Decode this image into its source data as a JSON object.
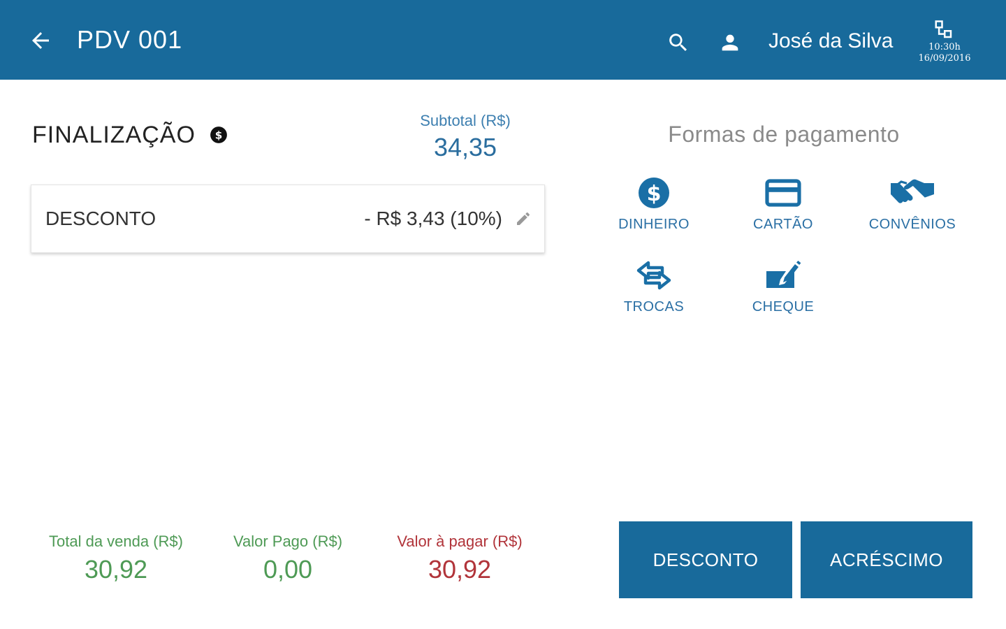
{
  "header": {
    "title": "PDV 001",
    "user_name": "José da Silva",
    "time": "10:30h",
    "date": "16/09/2016",
    "color": "#186a9b"
  },
  "finalization": {
    "title": "FINALIZAÇÃO",
    "subtotal_label": "Subtotal (R$)",
    "subtotal_value": "34,35",
    "discount_label": "DESCONTO",
    "discount_value": "- R$ 3,43 (10%)"
  },
  "payments": {
    "title": "Formas de pagamento",
    "options": [
      {
        "label": "DINHEIRO",
        "icon": "dollar-coin-icon"
      },
      {
        "label": "CARTÃO",
        "icon": "credit-card-icon"
      },
      {
        "label": "CONVÊNIOS",
        "icon": "handshake-icon"
      },
      {
        "label": "TROCAS",
        "icon": "exchange-arrows-icon"
      },
      {
        "label": "CHEQUE",
        "icon": "check-sign-icon"
      }
    ]
  },
  "summary": {
    "total_label": "Total da venda (R$)",
    "total_value": "30,92",
    "paid_label": "Valor Pago (R$)",
    "paid_value": "0,00",
    "due_label": "Valor à pagar (R$)",
    "due_value": "30,92"
  },
  "actions": {
    "discount": "DESCONTO",
    "surcharge": "ACRÉSCIMO"
  }
}
